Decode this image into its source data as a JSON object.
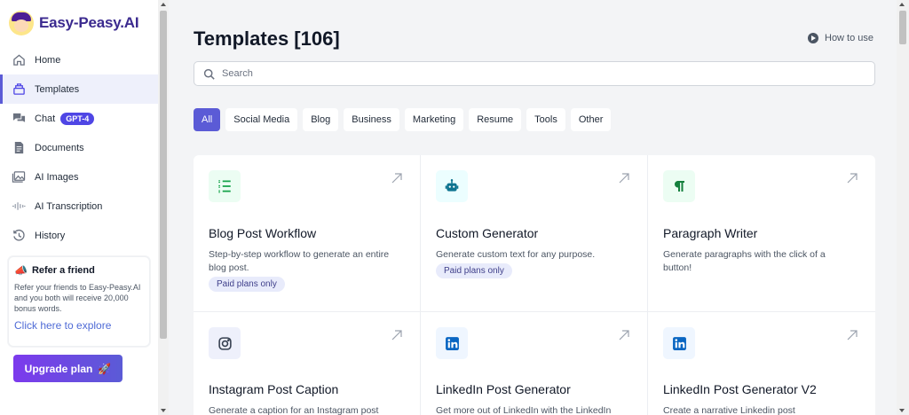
{
  "app": {
    "name": "Easy-Peasy.AI"
  },
  "sidebar": {
    "items": [
      {
        "label": "Home",
        "icon": "home-icon"
      },
      {
        "label": "Templates",
        "icon": "templates-icon",
        "active": true
      },
      {
        "label": "Chat",
        "icon": "chat-icon",
        "badge": "GPT-4"
      },
      {
        "label": "Documents",
        "icon": "document-icon"
      },
      {
        "label": "AI Images",
        "icon": "image-icon"
      },
      {
        "label": "AI Transcription",
        "icon": "waveform-icon"
      },
      {
        "label": "History",
        "icon": "history-icon"
      }
    ],
    "refer": {
      "title": "Refer a friend",
      "text": "Refer your friends to Easy-Peasy.AI and you both will receive 20,000 bonus words.",
      "link": "Click here to explore"
    },
    "upgrade_label": "Upgrade plan"
  },
  "main": {
    "title": "Templates [106]",
    "howto_label": "How to use",
    "search_placeholder": "Search",
    "filters": [
      "All",
      "Social Media",
      "Blog",
      "Business",
      "Marketing",
      "Resume",
      "Tools",
      "Other"
    ],
    "active_filter": "All",
    "cards": [
      {
        "title": "Blog Post Workflow",
        "desc": "Step-by-step workflow to generate an entire blog post.",
        "badge": "Paid plans only",
        "icon": "list-icon",
        "color": "#16a34a",
        "bg": "#ecfdf3"
      },
      {
        "title": "Custom Generator",
        "desc": "Generate custom text for any purpose.",
        "badge": "Paid plans only",
        "icon": "robot-icon",
        "color": "#0e7490",
        "bg": "#ecfeff"
      },
      {
        "title": "Paragraph Writer",
        "desc": "Generate paragraphs with the click of a button!",
        "badge": "",
        "icon": "paragraph-icon",
        "color": "#15803d",
        "bg": "#ecfdf3"
      },
      {
        "title": "Instagram Post Caption",
        "desc": "Generate a caption for an Instagram post",
        "badge": "",
        "icon": "instagram-icon",
        "color": "#374151",
        "bg": "#eef0fb"
      },
      {
        "title": "LinkedIn Post Generator",
        "desc": "Get more out of LinkedIn with the LinkedIn",
        "badge": "",
        "icon": "linkedin-icon",
        "color": "#0a66c2",
        "bg": "#eff6ff"
      },
      {
        "title": "LinkedIn Post Generator V2",
        "desc": "Create a narrative Linkedin post",
        "badge": "",
        "icon": "linkedin-icon",
        "color": "#0a66c2",
        "bg": "#eff6ff"
      }
    ]
  }
}
